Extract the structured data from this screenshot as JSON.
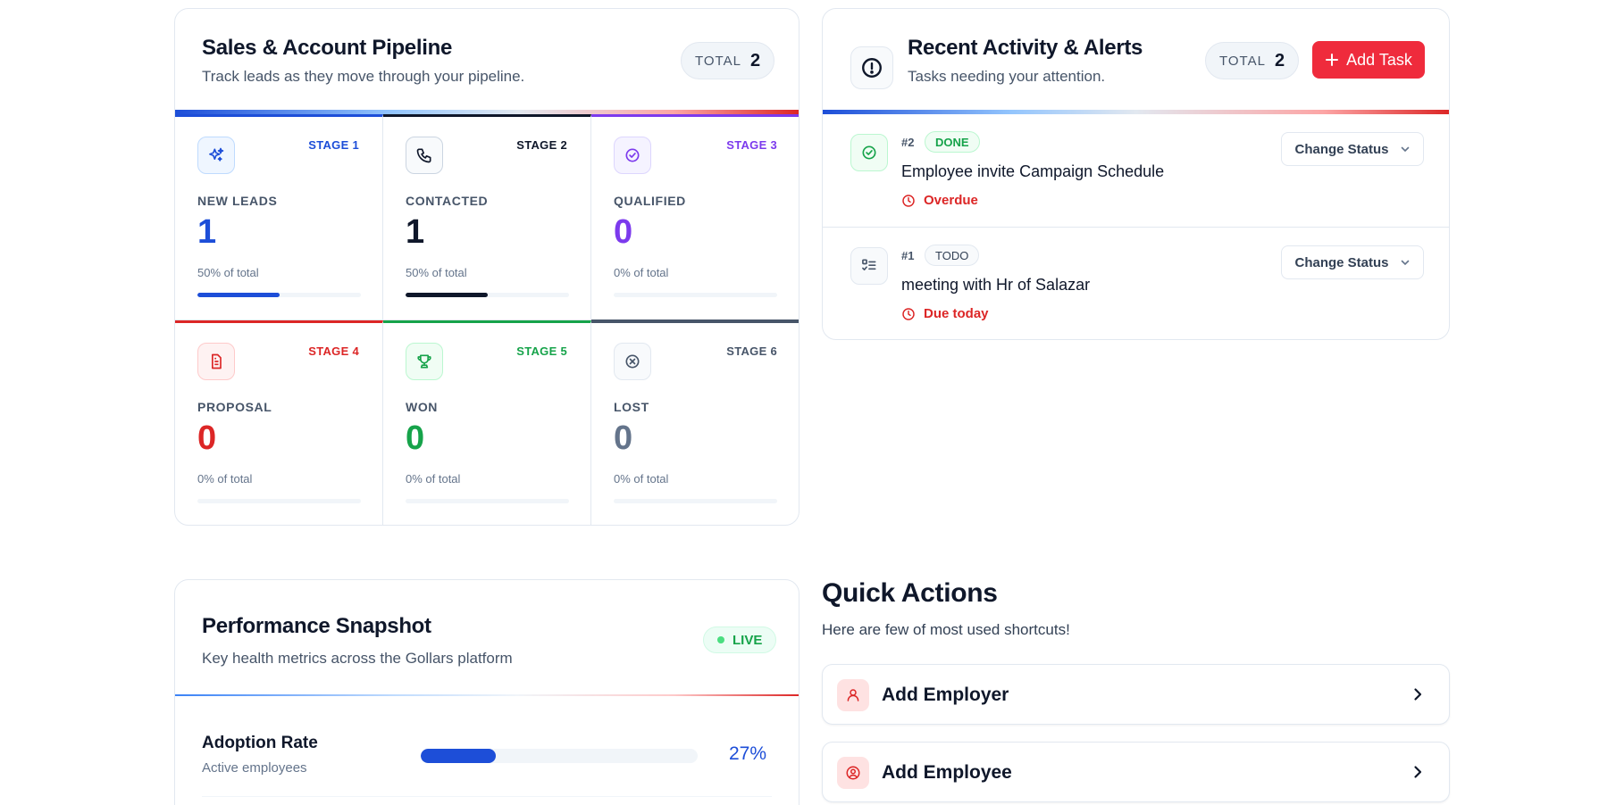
{
  "pipeline": {
    "title": "Sales & Account Pipeline",
    "subtitle": "Track leads as they move through your pipeline.",
    "total_label": "TOTAL",
    "total_value": "2",
    "stages": [
      {
        "stage": "STAGE 1",
        "name": "NEW LEADS",
        "count": "1",
        "pct_text": "50% of total",
        "progress": 0.5,
        "color": "#1d4ed8",
        "icon": "sparkles-icon"
      },
      {
        "stage": "STAGE 2",
        "name": "CONTACTED",
        "count": "1",
        "pct_text": "50% of total",
        "progress": 0.5,
        "color": "#0f172a",
        "icon": "phone-icon"
      },
      {
        "stage": "STAGE 3",
        "name": "QUALIFIED",
        "count": "0",
        "pct_text": "0% of total",
        "progress": 0,
        "color": "#7c3aed",
        "icon": "check-circle-icon"
      },
      {
        "stage": "STAGE 4",
        "name": "PROPOSAL",
        "count": "0",
        "pct_text": "0% of total",
        "progress": 0,
        "color": "#dc2626",
        "icon": "document-icon"
      },
      {
        "stage": "STAGE 5",
        "name": "WON",
        "count": "0",
        "pct_text": "0% of total",
        "progress": 0,
        "color": "#16a34a",
        "icon": "trophy-icon"
      },
      {
        "stage": "STAGE 6",
        "name": "LOST",
        "count": "0",
        "pct_text": "0% of total",
        "progress": 0,
        "color": "#475569",
        "icon": "x-circle-icon"
      }
    ]
  },
  "activity": {
    "title": "Recent Activity & Alerts",
    "subtitle": "Tasks needing your attention.",
    "total_label": "TOTAL",
    "total_value": "2",
    "add_task_label": "Add Task",
    "tasks": [
      {
        "id": "#2",
        "status": "DONE",
        "title": "Employee invite Campaign Schedule",
        "due": "Overdue",
        "action": "Change Status"
      },
      {
        "id": "#1",
        "status": "TODO",
        "title": "meeting with Hr of Salazar",
        "due": "Due today",
        "action": "Change Status"
      }
    ]
  },
  "performance": {
    "title": "Performance Snapshot",
    "subtitle": "Key health metrics across the Gollars platform",
    "live_label": "LIVE",
    "metrics": [
      {
        "name": "Adoption Rate",
        "sub": "Active employees",
        "value": "27%",
        "progress": 0.27
      }
    ]
  },
  "quick_actions": {
    "title": "Quick Actions",
    "subtitle": "Here are few of most used shortcuts!",
    "items": [
      {
        "label": "Add Employer",
        "icon": "user-icon"
      },
      {
        "label": "Add Employee",
        "icon": "user-circle-icon"
      }
    ]
  },
  "colors": {
    "accent_red": "#ef2b3c",
    "accent_blue": "#1d4ed8",
    "done_green": "#16a34a",
    "overdue_red": "#dc2626"
  }
}
